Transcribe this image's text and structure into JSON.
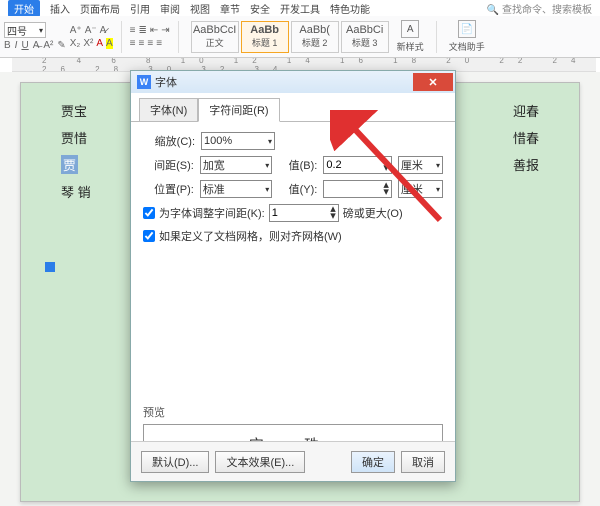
{
  "menubar": {
    "active": "开始",
    "items": [
      "插入",
      "页面布局",
      "引用",
      "审阅",
      "视图",
      "章节",
      "安全",
      "开发工具",
      "特色功能"
    ],
    "search_hint": "查找命令、搜索模板"
  },
  "toolbar": {
    "font_size": "四号",
    "styles": [
      {
        "sample": "AaBbCcI",
        "name": "正文"
      },
      {
        "sample": "AaBb",
        "name": "标题 1"
      },
      {
        "sample": "AaBb(",
        "name": "标题 2"
      },
      {
        "sample": "AaBbCi",
        "name": "标题 3"
      }
    ],
    "new_style": "新样式",
    "doc_assist": "文档助手"
  },
  "ruler_marks": "2 4 6 8 10 12 14 16 18 20 22 24 26 28 30 32 34",
  "document": {
    "lines": [
      {
        "left": "贾宝",
        "right": "迎春"
      },
      {
        "left": "贾惜",
        "right": "惜春"
      },
      {
        "left_sel": "贾",
        "right": "善报"
      },
      {
        "left": "琴 销",
        "right": ""
      }
    ]
  },
  "dialog": {
    "title": "字体",
    "tabs": {
      "font": "字体(N)",
      "spacing": "字符间距(R)"
    },
    "scale_label": "缩放(C):",
    "scale_value": "100%",
    "spacing_label": "间距(S):",
    "spacing_value": "加宽",
    "value_b_label": "值(B):",
    "value_b": "0.2",
    "value_b_unit": "厘米",
    "position_label": "位置(P):",
    "position_value": "标准",
    "value_y_label": "值(Y):",
    "value_y": "",
    "value_y_unit": "厘米",
    "kerning_chk": "为字体调整字间距(K):",
    "kerning_val": "1",
    "kerning_unit": "磅或更大(O)",
    "snap_chk": "如果定义了文档网格，则对齐网格(W)",
    "preview_label": "预览",
    "preview_text": "宝 珠",
    "btn_default": "默认(D)...",
    "btn_effects": "文本效果(E)...",
    "btn_ok": "确定",
    "btn_cancel": "取消"
  }
}
